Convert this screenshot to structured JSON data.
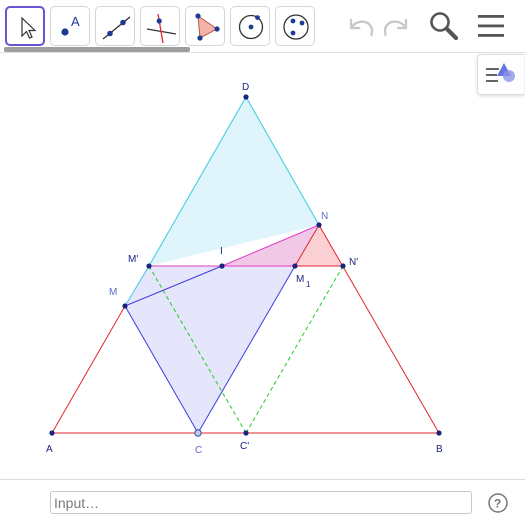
{
  "toolbar": {
    "tools": [
      {
        "name": "move-tool",
        "icon": "cursor-arrow-icon",
        "active": true
      },
      {
        "name": "point-tool",
        "icon": "point-icon",
        "label": "A"
      },
      {
        "name": "line-tool",
        "icon": "line-through-points-icon"
      },
      {
        "name": "perpendicular-line-tool",
        "icon": "perpendicular-line-icon"
      },
      {
        "name": "polygon-tool",
        "icon": "polygon-icon"
      },
      {
        "name": "circle-tool",
        "icon": "circle-center-point-icon"
      },
      {
        "name": "circle-three-points-tool",
        "icon": "circle-three-points-icon"
      }
    ],
    "undo_icon": "undo-icon",
    "redo_icon": "redo-icon",
    "search_icon": "search-icon",
    "menu_icon": "hamburger-menu-icon"
  },
  "style_bar_toggle": {
    "icon": "style-bar-icon"
  },
  "construction": {
    "labels": {
      "A": "A",
      "B": "B",
      "C": "C",
      "D": "D",
      "M": "M",
      "N": "N",
      "I": "I",
      "M_prime": "M'",
      "N_prime": "N'",
      "C_prime": "C'",
      "M1": "M",
      "M1_sub": "1"
    },
    "colors": {
      "triangle_abd_lower": "#e3262a",
      "triangle_upper": "#38c9e8",
      "upper_fill": "#dff5fb",
      "polygon_blue": "#3d3ee0",
      "polygon_blue_fill": "#e5e5fb",
      "pink_fill": "#f1c8e6",
      "red_triangle_fill": "#fbd0d3",
      "magenta_segment": "#e23cc6",
      "dashed_green": "#22cc22",
      "point_dark": "#1a237e",
      "label_blue": "#5c6bc0"
    }
  },
  "input_bar": {
    "placeholder": "Input…",
    "help_icon": "help-circle-icon",
    "help_label": "?"
  }
}
